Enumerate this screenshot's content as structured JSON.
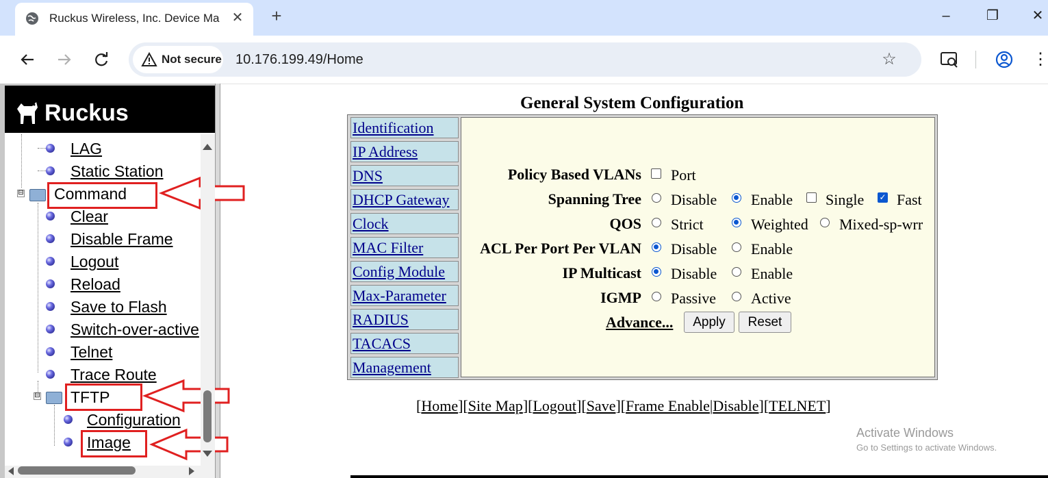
{
  "browser": {
    "tab_title": "Ruckus Wireless, Inc. Device Ma",
    "tab_close": "✕",
    "new_tab": "+",
    "security_label": "Not secure",
    "url": "10.176.199.49/Home",
    "window_controls": {
      "minimize": "–",
      "restore": "❐",
      "close": "✕"
    }
  },
  "sidebar": {
    "logo_text": "Ruckus",
    "items": [
      {
        "label": "LAG",
        "type": "link"
      },
      {
        "label": "Static Station",
        "type": "link"
      },
      {
        "label": "Command",
        "type": "folder"
      },
      {
        "label": "Clear",
        "type": "link"
      },
      {
        "label": "Disable Frame",
        "type": "link"
      },
      {
        "label": "Logout",
        "type": "link"
      },
      {
        "label": "Reload",
        "type": "link"
      },
      {
        "label": "Save to Flash",
        "type": "link"
      },
      {
        "label": "Switch-over-active",
        "type": "link"
      },
      {
        "label": "Telnet",
        "type": "link"
      },
      {
        "label": "Trace Route",
        "type": "link"
      },
      {
        "label": "TFTP",
        "type": "folder"
      },
      {
        "label": "Configuration",
        "type": "link"
      },
      {
        "label": "Image",
        "type": "link"
      }
    ],
    "expander_symbol": "⊟"
  },
  "main": {
    "title": "General System Configuration",
    "menu": [
      "Identification",
      "IP Address",
      "DNS",
      "DHCP Gateway",
      "Clock",
      "MAC Filter",
      "Config Module",
      "Max-Parameter",
      "RADIUS",
      "TACACS",
      "Management"
    ],
    "settings": {
      "policy_vlans": {
        "label": "Policy Based VLANs",
        "port": "Port",
        "port_checked": false
      },
      "spanning_tree": {
        "label": "Spanning Tree",
        "disable": "Disable",
        "enable": "Enable",
        "selected": "Enable",
        "single": "Single",
        "single_checked": false,
        "fast": "Fast",
        "fast_checked": true
      },
      "qos": {
        "label": "QOS",
        "strict": "Strict",
        "weighted": "Weighted",
        "mixed": "Mixed-sp-wrr",
        "selected": "Weighted"
      },
      "acl": {
        "label": "ACL Per Port Per VLAN",
        "disable": "Disable",
        "enable": "Enable",
        "selected": "Disable"
      },
      "ip_multicast": {
        "label": "IP Multicast",
        "disable": "Disable",
        "enable": "Enable",
        "selected": "Disable"
      },
      "igmp": {
        "label": "IGMP",
        "passive": "Passive",
        "active": "Active",
        "selected": null
      }
    },
    "advance_label": "Advance...",
    "apply_label": "Apply",
    "reset_label": "Reset"
  },
  "footer": {
    "open_bracket": "[",
    "close_bracket": "]",
    "home": "Home",
    "site_map": "Site Map",
    "logout": "Logout",
    "save": "Save",
    "frame_enable": "Frame Enable",
    "pipe": "|",
    "disable": "Disable",
    "telnet": "TELNET"
  },
  "watermark": {
    "title": "Activate Windows",
    "subtitle": "Go to Settings to activate Windows."
  },
  "colors": {
    "annotation_red": "#e02020",
    "menu_cell_bg": "#c6e2e9",
    "panel_bg": "#fcfce8",
    "link_blue": "#00008b"
  }
}
